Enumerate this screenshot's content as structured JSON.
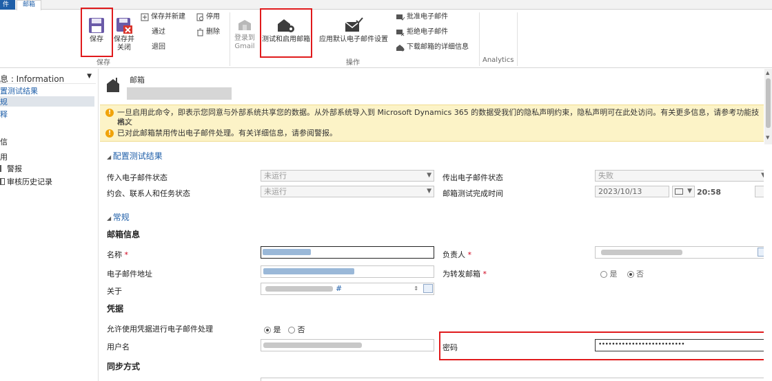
{
  "ribbon": {
    "tab_file": "件",
    "tab_mailbox": "邮箱",
    "save": "保存",
    "save_close_1": "保存并",
    "save_close_2": "关闭",
    "save_new": "保存并新建",
    "approve": "通过",
    "reject_back": "退回",
    "deactivate": "停用",
    "delete": "删除",
    "login_1": "登录到",
    "login_2": "Gmail",
    "test_enable": "测试和启用邮箱",
    "apply_default": "应用默认电子邮件设置",
    "approve_email": "批准电子邮件",
    "reject_email": "拒绝电子邮件",
    "download_details": "下载邮箱的详细信息",
    "group_save": "保存",
    "group_actions": "操作",
    "group_analytics": "Analytics"
  },
  "leftnav": {
    "header": "息 : Information",
    "items": [
      "置测试结果",
      "规",
      "释"
    ],
    "section_a": "信",
    "section_b": "用",
    "link_alerts": "警报",
    "link_audit": "审核历史记录"
  },
  "header": {
    "entity": "邮箱"
  },
  "warnings": [
    "一旦启用此命令，即表示您同意与外部系统共享您的数据。从外部系统导入到 Microsoft Dynamics 365 的数据受我们的隐私声明约束，隐私声明可在此处访问。有关更多信息，请参考功能技术文",
    "档。",
    "已对此邮箱禁用传出电子邮件处理。有关详细信息，请参阅警报。"
  ],
  "config_section": {
    "title": "配置测试结果",
    "incoming_label": "传入电子邮件状态",
    "incoming_value": "未运行",
    "outgoing_label": "传出电子邮件状态",
    "outgoing_value": "失败",
    "appointments_label": "约会、联系人和任务状态",
    "appointments_value": "未运行",
    "test_time_label": "邮箱测试完成时间",
    "test_date": "2023/10/13",
    "test_time": "20:58"
  },
  "general_section": {
    "title": "常规",
    "mailbox_info": "邮箱信息",
    "name_label": "名称",
    "owner_label": "负责人",
    "email_label": "电子邮件地址",
    "forward_label": "为转发邮箱",
    "yes": "是",
    "no": "否",
    "regarding_label": "关于",
    "regarding_suffix": "#",
    "credentials": "凭据",
    "allow_credentials_label": "允许使用凭据进行电子邮件处理",
    "username_label": "用户名",
    "password_label": "密码",
    "password_value": "••••••••••••••••••••••••••",
    "sync_method": "同步方式"
  },
  "colors": {
    "accent": "#1f5fa9",
    "highlight_box": "#e0191b",
    "warning_bg": "#fcf3c7",
    "warning_icon": "#f0a30a"
  }
}
